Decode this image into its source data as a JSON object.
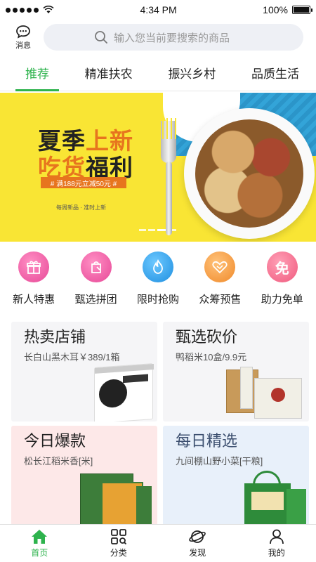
{
  "status": {
    "time": "4:34 PM",
    "battery": "100%"
  },
  "header": {
    "messages_label": "消息",
    "search_placeholder": "输入您当前要搜索的商品"
  },
  "tabs": [
    {
      "label": "推荐",
      "active": true
    },
    {
      "label": "精准扶农",
      "active": false
    },
    {
      "label": "振兴乡村",
      "active": false
    },
    {
      "label": "品质生活",
      "active": false
    }
  ],
  "banner": {
    "line1_a": "夏季",
    "line1_b": "上新",
    "line2_a": "吃货",
    "line2_b": "福利",
    "badge": "# 满188元立减50元 #",
    "note": "每周新品 · 准时上新"
  },
  "categories": [
    {
      "label": "新人特惠",
      "icon": "gift-icon",
      "color": "#f05fa4"
    },
    {
      "label": "甄选拼团",
      "icon": "shopping-bag-icon",
      "color": "#f05fa4"
    },
    {
      "label": "限时抢购",
      "icon": "flame-icon",
      "color": "#2fa0e8"
    },
    {
      "label": "众筹预售",
      "icon": "handshake-icon",
      "color": "#f6a34a"
    },
    {
      "label": "助力免单",
      "icon": "free-badge-icon",
      "color": "#f46c8a",
      "glyph": "免"
    }
  ],
  "cards": [
    {
      "title": "热卖店铺",
      "subtitle": "长白山黑木耳￥389/1箱"
    },
    {
      "title": "甄选砍价",
      "subtitle": "鸭稻米10盒/9.9元"
    },
    {
      "title": "今日爆款",
      "subtitle": "松长江稻米香[米]"
    },
    {
      "title": "每日精选",
      "subtitle": "九间棚山野小菜[干粮]"
    }
  ],
  "nav": [
    {
      "label": "首页",
      "icon": "home-icon",
      "active": true
    },
    {
      "label": "分类",
      "icon": "category-grid-icon",
      "active": false
    },
    {
      "label": "发现",
      "icon": "discover-planet-icon",
      "active": false
    },
    {
      "label": "我的",
      "icon": "user-icon",
      "active": false
    }
  ],
  "colors": {
    "accent": "#2eb34d",
    "banner_bg": "#f9e534",
    "banner_orange": "#e7751e"
  }
}
